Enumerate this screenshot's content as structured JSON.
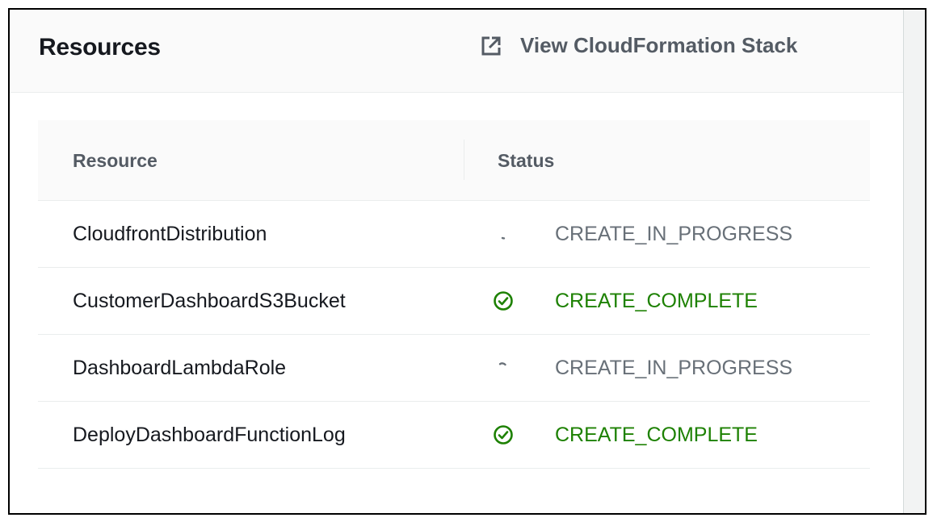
{
  "panel": {
    "title": "Resources",
    "link": {
      "label": "View CloudFormation Stack",
      "icon": "external-link-icon"
    }
  },
  "table": {
    "columns": [
      "Resource",
      "Status"
    ],
    "rows": [
      {
        "resource": "CloudfrontDistribution",
        "status": "CREATE_IN_PROGRESS",
        "status_icon": "spinner-icon"
      },
      {
        "resource": "CustomerDashboardS3Bucket",
        "status": "CREATE_COMPLETE",
        "status_icon": "check-circle-icon"
      },
      {
        "resource": "DashboardLambdaRole",
        "status": "CREATE_IN_PROGRESS",
        "status_icon": "spinner-icon"
      },
      {
        "resource": "DeployDashboardFunctionLog",
        "status": "CREATE_COMPLETE",
        "status_icon": "check-circle-icon"
      }
    ]
  },
  "colors": {
    "complete": "#1d8102",
    "in_progress": "#687078",
    "header_bg": "#fafafa"
  }
}
